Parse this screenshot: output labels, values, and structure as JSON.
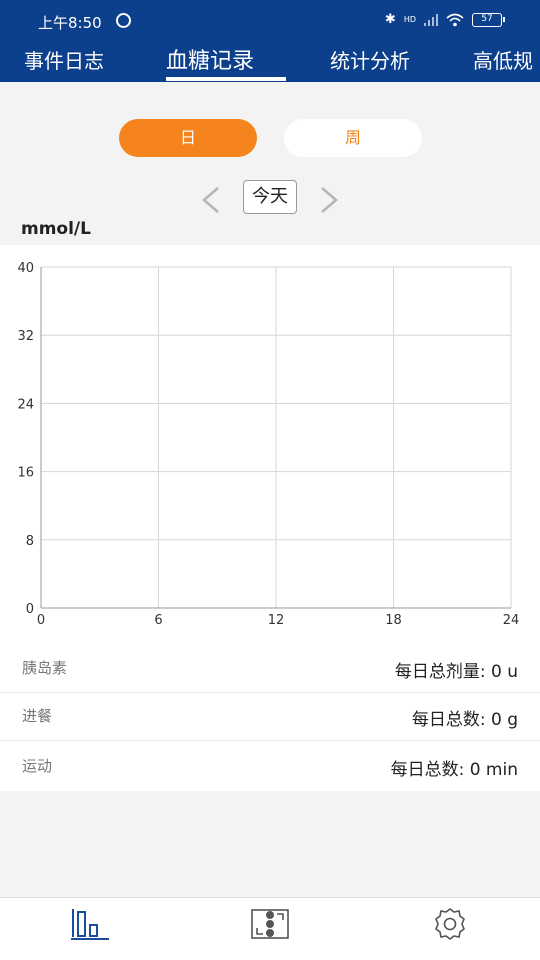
{
  "status": {
    "time": "上午8:50",
    "hd": "HD",
    "battery": "57"
  },
  "tabs": [
    {
      "label": "事件日志"
    },
    {
      "label": "血糖记录"
    },
    {
      "label": "统计分析"
    },
    {
      "label": "高低规"
    }
  ],
  "segment": {
    "day": "日",
    "week": "周"
  },
  "date_nav": {
    "today": "今天"
  },
  "unit_label": "mmol/L",
  "chart_data": {
    "type": "line",
    "x_ticks": [
      "0",
      "6",
      "12",
      "18",
      "24"
    ],
    "y_ticks": [
      "0",
      "8",
      "16",
      "24",
      "32",
      "40"
    ],
    "xlim": [
      0,
      24
    ],
    "ylim": [
      0,
      40
    ],
    "grid": true,
    "series": []
  },
  "rows": [
    {
      "label": "胰岛素",
      "value": "每日总剂量: 0 u"
    },
    {
      "label": "进餐",
      "value": "每日总数: 0 g"
    },
    {
      "label": "运动",
      "value": "每日总数: 0 min"
    }
  ],
  "colors": {
    "header": "#0c3f8c",
    "accent": "#f5841f",
    "icon": "#1c4d9c"
  },
  "bottom_nav": [
    "chart-icon",
    "sync-icon",
    "settings-icon"
  ]
}
